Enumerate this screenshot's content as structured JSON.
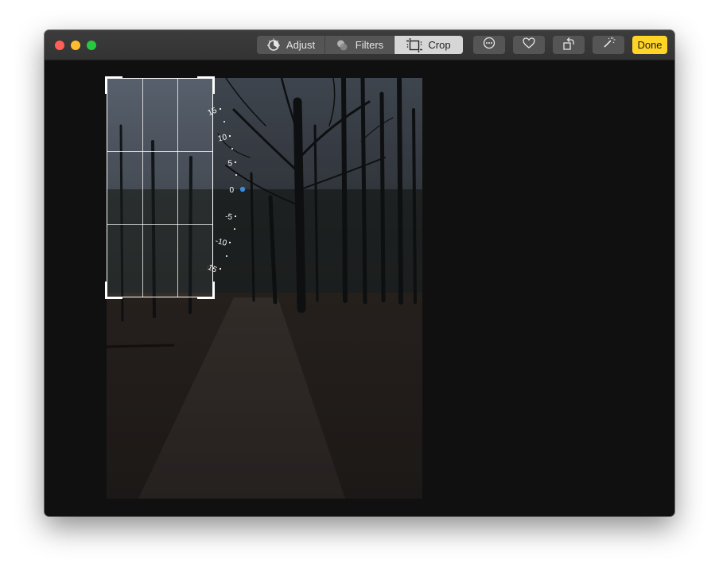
{
  "toolbar": {
    "tabs": [
      {
        "label": "Adjust",
        "icon": "adjust-dial-icon",
        "selected": false
      },
      {
        "label": "Filters",
        "icon": "filters-circles-icon",
        "selected": false
      },
      {
        "label": "Crop",
        "icon": "crop-icon",
        "selected": true
      }
    ],
    "buttons": [
      "more-options-icon",
      "heart-icon",
      "rotate-icon",
      "magic-wand-icon"
    ],
    "done_label": "Done"
  },
  "straighten_dial": {
    "ticks": [
      "15",
      "10",
      "5",
      "0",
      "-5",
      "-10",
      "-15"
    ],
    "current_value": 0,
    "indicator_color": "#3b8bdc"
  },
  "colors": {
    "done_bg": "#ffd426",
    "selected_tab_bg": "#d6d6d6",
    "window_bg": "#101010"
  }
}
